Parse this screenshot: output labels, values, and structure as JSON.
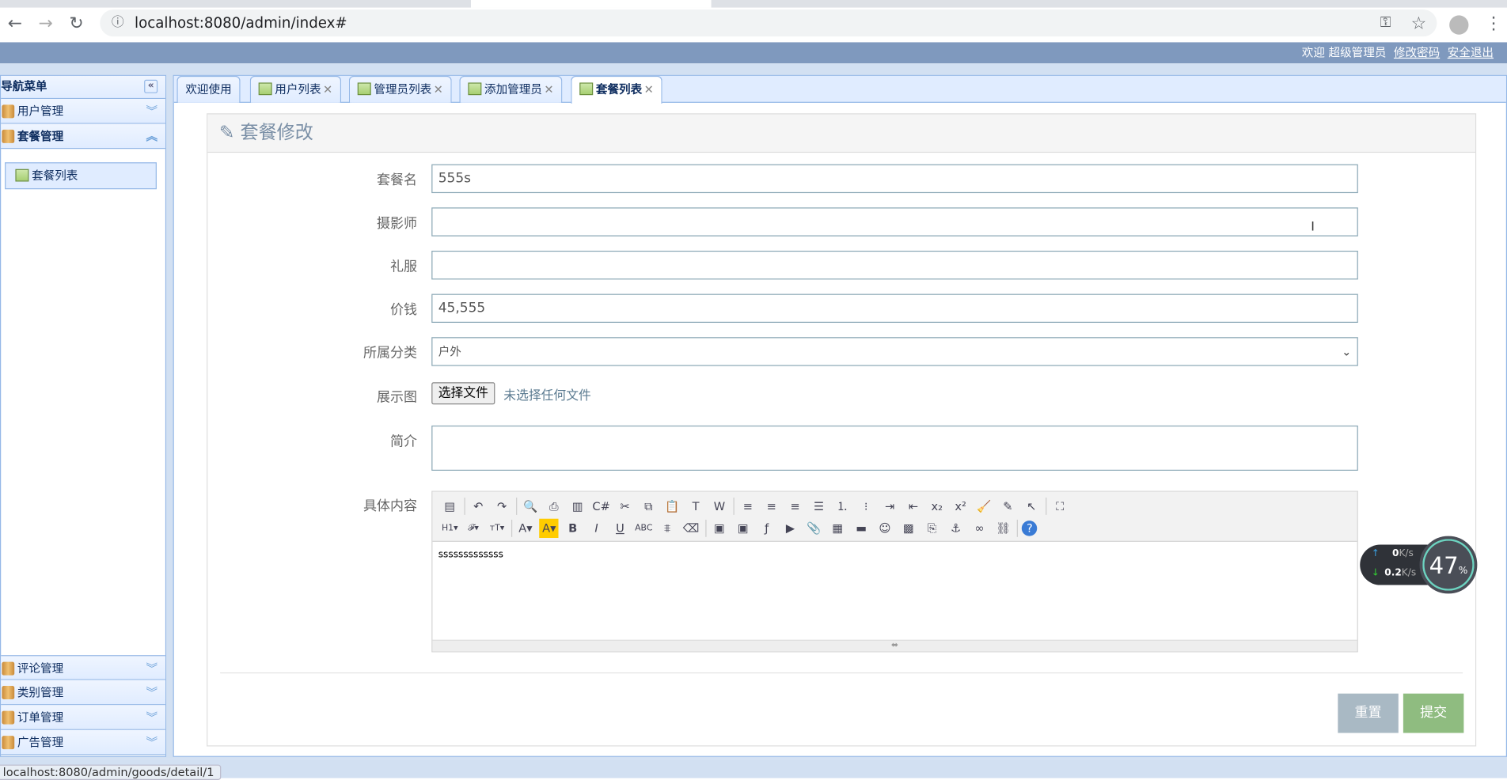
{
  "browser": {
    "url": "localhost:8080/admin/index#"
  },
  "header": {
    "welcome": "欢迎 超级管理员",
    "change_password": "修改密码",
    "logout": "安全退出"
  },
  "sidebar": {
    "title": "导航菜单",
    "groups_top": [
      {
        "label": "用户管理"
      },
      {
        "label": "套餐管理"
      }
    ],
    "sub_item": "套餐列表",
    "groups_bottom": [
      {
        "label": "评论管理"
      },
      {
        "label": "类别管理"
      },
      {
        "label": "订单管理"
      },
      {
        "label": "广告管理"
      }
    ]
  },
  "tabs": [
    {
      "label": "欢迎使用"
    },
    {
      "label": "用户列表"
    },
    {
      "label": "管理员列表"
    },
    {
      "label": "添加管理员"
    },
    {
      "label": "套餐列表"
    }
  ],
  "form": {
    "title": "套餐修改",
    "name_label": "套餐名",
    "name_value": "555s",
    "photographer_label": "摄影师",
    "photographer_value": "",
    "dress_label": "礼服",
    "dress_value": "",
    "price_label": "价钱",
    "price_value": "45,555",
    "category_label": "所属分类",
    "category_value": "户外",
    "image_label": "展示图",
    "file_button": "选择文件",
    "file_status": "未选择任何文件",
    "intro_label": "简介",
    "intro_value": "",
    "content_label": "具体内容",
    "content_value": "sssssssssssss",
    "reset": "重置",
    "submit": "提交"
  },
  "editor_toolbar": {
    "row1": [
      "source-icon",
      "|",
      "undo-icon",
      "redo-icon",
      "|",
      "preview-icon",
      "print-icon",
      "template-icon",
      "code-icon",
      "cut-icon",
      "copy-icon",
      "paste-icon",
      "paste-text-icon",
      "paste-word-icon",
      "|",
      "align-left-icon",
      "align-center-icon",
      "align-right-icon",
      "justify-icon",
      "ordered-list-icon",
      "unordered-list-icon",
      "indent-icon",
      "outdent-icon",
      "subscript-icon",
      "superscript-icon",
      "clear-format-icon",
      "select-all-icon",
      "select-icon",
      "|",
      "fullscreen-icon"
    ],
    "row2": [
      "heading-icon",
      "font-family-icon",
      "font-size-icon",
      "|",
      "text-color-icon",
      "highlight-color-icon",
      "bold-icon",
      "italic-icon",
      "underline-icon",
      "strikethrough-icon",
      "line-height-icon",
      "remove-format-icon",
      "|",
      "image-icon",
      "multi-image-icon",
      "flash-icon",
      "media-icon",
      "attachment-icon",
      "table-icon",
      "horizontal-rule-icon",
      "emoticon-icon",
      "map-icon",
      "pagebreak-icon",
      "anchor-icon",
      "link-icon",
      "unlink-icon",
      "|",
      "about-icon"
    ]
  },
  "speed": {
    "upload": "0",
    "download": "0.2",
    "unit": "K/s",
    "percent": "47",
    "percent_sign": "%"
  },
  "status_url": "localhost:8080/admin/goods/detail/1",
  "colors": {
    "header": "#7f99be",
    "border": "#95b8e7",
    "reset": "#a9b9c4",
    "submit": "#8fbc80"
  }
}
